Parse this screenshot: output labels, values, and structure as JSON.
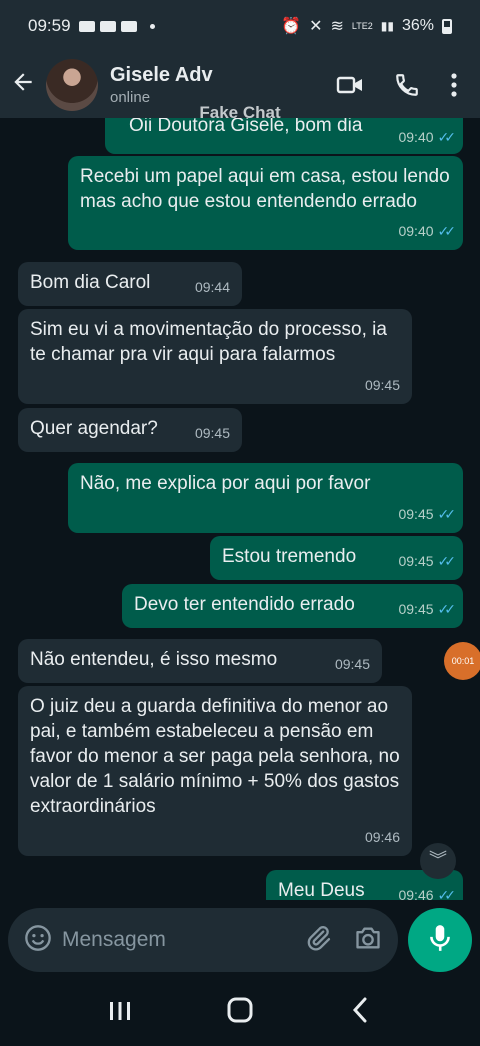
{
  "status_bar": {
    "time": "09:59",
    "battery": "36%",
    "network": "LTE2"
  },
  "header": {
    "contact_name": "Gisele Adv",
    "contact_status": "online",
    "icons": [
      "back-arrow-icon",
      "video-call-icon",
      "phone-icon",
      "more-vert-icon"
    ]
  },
  "watermark": "Fake Chat",
  "messages": [
    {
      "dir": "out",
      "text": "Oii Doutora Gisele, bom dia",
      "time": "09:40",
      "ticks": "✓✓"
    },
    {
      "dir": "out",
      "text": "Recebi um papel aqui em casa, estou lendo mas acho que estou entendendo errado",
      "time": "09:40",
      "ticks": "✓✓"
    },
    {
      "dir": "in",
      "text": "Bom dia Carol",
      "time": "09:44"
    },
    {
      "dir": "in",
      "text": "Sim eu vi a movimentação do processo, ia te chamar pra vir aqui para falarmos",
      "time": "09:45"
    },
    {
      "dir": "in",
      "text": "Quer agendar?",
      "time": "09:45"
    },
    {
      "dir": "out",
      "text": "Não, me explica por aqui por favor",
      "time": "09:45",
      "ticks": "✓✓"
    },
    {
      "dir": "out",
      "text": "Estou tremendo",
      "time": "09:45",
      "ticks": "✓✓"
    },
    {
      "dir": "out",
      "text": "Devo ter entendido errado",
      "time": "09:45",
      "ticks": "✓✓"
    },
    {
      "dir": "in",
      "text": "Não entendeu, é isso mesmo",
      "time": "09:45"
    },
    {
      "dir": "in",
      "text": "O juiz deu a guarda definitiva do menor ao pai, e também estabeleceu a pensão em favor do menor a ser paga pela senhora, no valor de 1 salário mínimo + 50% dos gastos extraordinários",
      "time": "09:46"
    },
    {
      "dir": "out",
      "text": "Meu Deus",
      "time": "09:46",
      "ticks": "✓✓"
    }
  ],
  "recording_badge": "00:01",
  "input": {
    "placeholder": "Mensagem"
  },
  "colors": {
    "incoming_bubble": "#1f2c34",
    "outgoing_bubble": "#005c4b",
    "accent": "#00a884",
    "read_ticks": "#53bdeb"
  }
}
